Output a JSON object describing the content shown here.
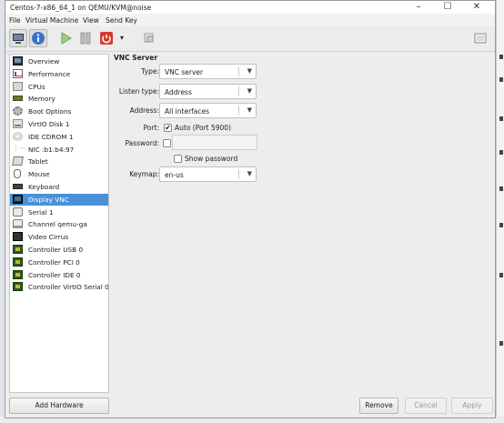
{
  "window": {
    "title": "Centos-7-x86_64_1 on QEMU/KVM@noise",
    "minimize_glyph": "–",
    "maximize_glyph": "☐",
    "close_glyph": "✕"
  },
  "menubar": {
    "items": [
      "File",
      "Virtual Machine",
      "View",
      "Send Key"
    ]
  },
  "toolbar": {
    "icons": [
      "console-icon",
      "details-info-icon",
      "run-play-icon",
      "pause-icon",
      "shutdown-power-icon",
      "shutdown-menu-arrow-icon",
      "snapshot-icon",
      "fullscreen-icon"
    ],
    "menu_arrow_glyph": "▾"
  },
  "hardware_list": {
    "items": [
      {
        "label": "Overview",
        "icon": "overview-icon"
      },
      {
        "label": "Performance",
        "icon": "performance-icon"
      },
      {
        "label": "CPUs",
        "icon": "cpu-icon"
      },
      {
        "label": "Memory",
        "icon": "memory-icon"
      },
      {
        "label": "Boot Options",
        "icon": "boot-options-icon"
      },
      {
        "label": "VirtIO Disk 1",
        "icon": "disk-icon"
      },
      {
        "label": "IDE CDROM 1",
        "icon": "cdrom-icon"
      },
      {
        "label": "NIC :b1:b4:97",
        "icon": "nic-icon"
      },
      {
        "label": "Tablet",
        "icon": "tablet-icon"
      },
      {
        "label": "Mouse",
        "icon": "mouse-icon"
      },
      {
        "label": "Keyboard",
        "icon": "keyboard-icon"
      },
      {
        "label": "Display VNC",
        "icon": "display-icon",
        "selected": true
      },
      {
        "label": "Serial 1",
        "icon": "serial-icon"
      },
      {
        "label": "Channel qemu-ga",
        "icon": "channel-icon"
      },
      {
        "label": "Video Cirrus",
        "icon": "video-icon"
      },
      {
        "label": "Controller USB 0",
        "icon": "controller-icon"
      },
      {
        "label": "Controller PCI 0",
        "icon": "controller-icon"
      },
      {
        "label": "Controller IDE 0",
        "icon": "controller-icon"
      },
      {
        "label": "Controller VirtIO Serial 0",
        "icon": "controller-icon"
      }
    ],
    "add_hardware_label": "Add Hardware",
    "selection_color": "#4a90d9"
  },
  "vnc_server": {
    "section_title": "VNC Server",
    "type_label": "Type:",
    "type_value": "VNC server",
    "listen_type_label": "Listen type:",
    "listen_type_value": "Address",
    "address_label": "Address:",
    "address_value": "All interfaces",
    "port_label": "Port:",
    "port_auto_checked": true,
    "port_auto_label": "Auto (Port 5900)",
    "password_label": "Password:",
    "password_checked": false,
    "password_value": "",
    "show_password_label": "Show password",
    "show_password_checked": false,
    "keymap_label": "Keymap:",
    "keymap_value": "en-us",
    "dropdown_glyph": "▼",
    "check_glyph": "✔"
  },
  "actions": {
    "remove_label": "Remove",
    "cancel_label": "Cancel",
    "apply_label": "Apply"
  }
}
